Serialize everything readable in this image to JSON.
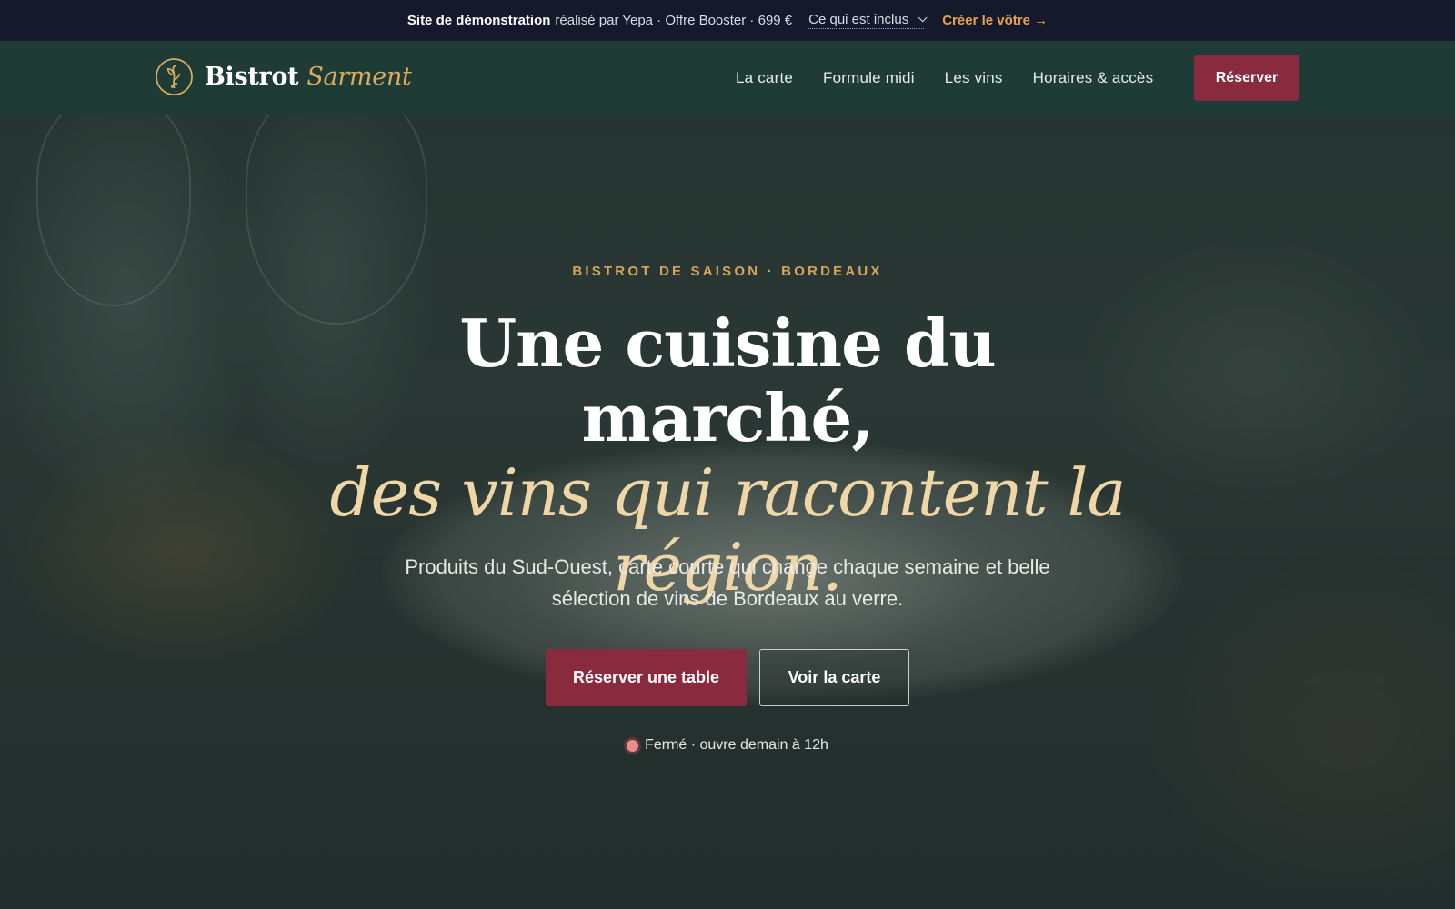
{
  "demo_banner": {
    "bold": "Site de démonstration",
    "text": "réalisé par Yepa · Offre Booster · 699 €",
    "included_label": "Ce qui est inclus",
    "create_label": "Créer le vôtre →"
  },
  "brand": {
    "name": "Bistrot",
    "accent": "Sarment",
    "accent_color": "#d9ac5e",
    "logo_icon": "vine-sprig-icon"
  },
  "nav": {
    "items": [
      {
        "label": "La carte"
      },
      {
        "label": "Formule midi"
      },
      {
        "label": "Les vins"
      },
      {
        "label": "Horaires & accès"
      }
    ],
    "reserve_label": "Réserver"
  },
  "hero": {
    "kicker": "BISTROT DE SAISON · BORDEAUX",
    "headline_line1": "Une cuisine du marché,",
    "headline_line2": "des vins qui racontent la région.",
    "subtitle": "Produits du Sud-Ouest, carte courte qui change chaque semaine et belle sélection de vins de Bordeaux au verre.",
    "cta_primary": "Réserver une table",
    "cta_secondary": "Voir la carte",
    "status": "Fermé · ouvre demain à 12h"
  },
  "colors": {
    "banner_bg": "#141a2c",
    "nav_bg": "#1e3b35",
    "accent_burgundy": "#8a2a3f",
    "accent_gold": "#d6a45a",
    "headline_italic": "#eed6a6"
  }
}
